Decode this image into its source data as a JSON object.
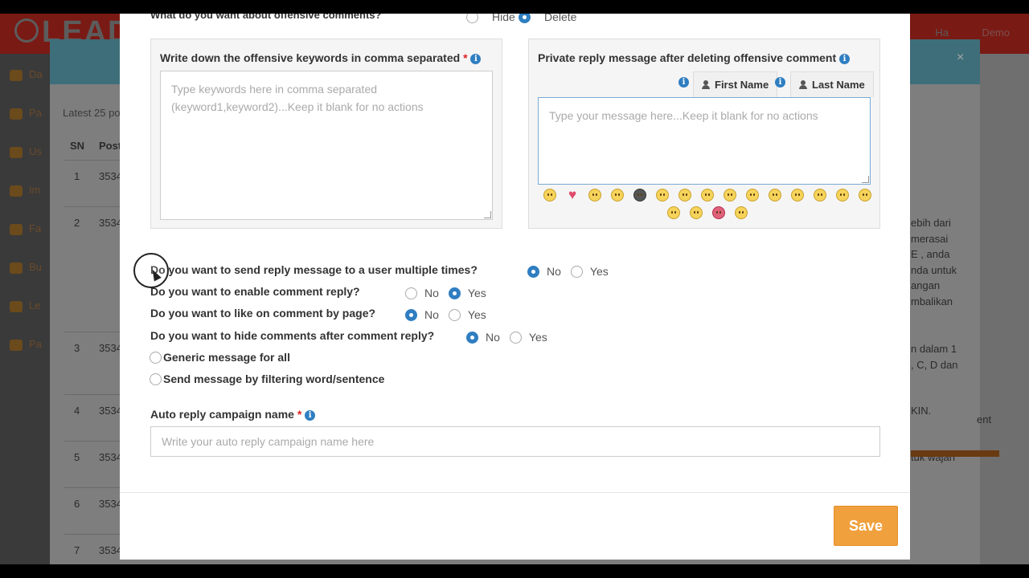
{
  "background": {
    "brand": "LEAD",
    "user_text": "Ha",
    "demo_text": "Demo",
    "sidebar_items": [
      "Da",
      "Pa",
      "Us",
      "Im",
      "Fa",
      "Bu",
      "Le",
      "Pa"
    ],
    "latest_text": "Latest 25 po",
    "table_headers": [
      "SN",
      "Post"
    ],
    "rows": [
      {
        "sn": "1",
        "post": "3534"
      },
      {
        "sn": "2",
        "post": "3534"
      },
      {
        "sn": "3",
        "post": "3534"
      },
      {
        "sn": "4",
        "post": "3534"
      },
      {
        "sn": "5",
        "post": "3534"
      },
      {
        "sn": "6",
        "post": "3534"
      },
      {
        "sn": "7",
        "post": "3534"
      }
    ],
    "right_text_row2": [
      "ebih dari",
      "merasai",
      "E , anda",
      "nda untuk",
      "angan",
      "mbalikan"
    ],
    "right_text_row3": [
      "n dalam 1",
      ", C, D dan"
    ],
    "right_text_row4": "KIN.",
    "right_text_row5": "tuk wajah",
    "right_text_ent": "ent",
    "close_glyph": "×"
  },
  "modal": {
    "cut_question": "What do you want about offensive comments?",
    "cut_options": [
      "Hide",
      "Delete"
    ],
    "keywords_panel": {
      "title": "Write down the offensive keywords in comma separated",
      "required_mark": "*",
      "placeholder": "Type keywords here in comma separated (keyword1,keyword2)...Keep it blank for no actions"
    },
    "private_reply_panel": {
      "title": "Private reply message after deleting offensive comment",
      "first_name_label": "First Name",
      "last_name_label": "Last Name",
      "placeholder": "Type your message here...Keep it blank for no actions"
    },
    "questions": [
      {
        "label": "Do you want to send reply message to a user multiple times?",
        "options": [
          "No",
          "Yes"
        ],
        "selected": "No"
      },
      {
        "label": "Do you want to enable comment reply?",
        "options": [
          "No",
          "Yes"
        ],
        "selected": "Yes"
      },
      {
        "label": "Do you want to like on comment by page?",
        "options": [
          "No",
          "Yes"
        ],
        "selected": "No"
      },
      {
        "label": "Do you want to hide comments after comment reply?",
        "options": [
          "No",
          "Yes"
        ],
        "selected": "No"
      }
    ],
    "message_type_options": [
      "Generic message for all",
      "Send message by filtering word/sentence"
    ],
    "campaign": {
      "label": "Auto reply campaign name",
      "required_mark": "*",
      "placeholder": "Write your auto reply campaign name here"
    },
    "save_label": "Save"
  },
  "icons": {
    "info": "info-icon",
    "person": "person-icon",
    "emojis": [
      "tongue-emoji",
      "heart-emoji",
      "grin-emoji",
      "smile-emoji",
      "sunglasses-emoji",
      "blush-emoji",
      "pacman-emoji",
      "frown-emoji",
      "nerd-emoji",
      "wink-tongue-emoji",
      "surprised-emoji",
      "angry-emoji",
      "angel-emoji",
      "confused-emoji",
      "neutral-emoji",
      "squint-emoji",
      "happy-emoji",
      "devil-emoji",
      "sad-emoji"
    ]
  },
  "colors": {
    "accent": "#2f7ec1",
    "save_button": "#f0a03c",
    "required": "#e02020"
  }
}
